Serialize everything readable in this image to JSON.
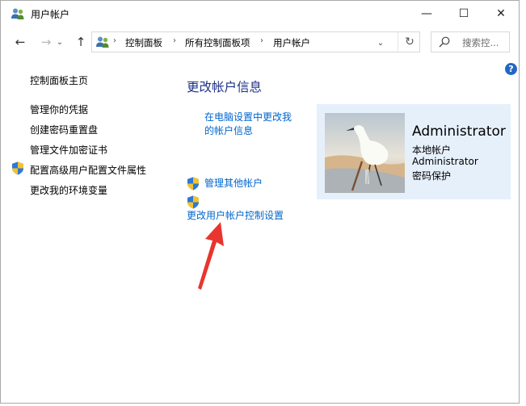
{
  "window": {
    "title": "用户帐户"
  },
  "titlebar": {
    "minimize": "—",
    "maximize": "☐",
    "close": "✕"
  },
  "nav": {
    "back_icon": "←",
    "forward_icon": "→",
    "recent_icon": "⌄",
    "up_icon": "↑",
    "breadcrumb": [
      "控制面板",
      "所有控制面板项",
      "用户帐户"
    ],
    "separator": "›",
    "dropdown_icon": "⌄",
    "refresh_icon": "↻",
    "search_placeholder": "搜索控..."
  },
  "help_label": "?",
  "sidebar": {
    "items": [
      {
        "label": "控制面板主页",
        "shield": false
      },
      {
        "label": "管理你的凭据",
        "shield": false
      },
      {
        "label": "创建密码重置盘",
        "shield": false
      },
      {
        "label": "管理文件加密证书",
        "shield": false
      },
      {
        "label": "配置高级用户配置文件属性",
        "shield": true
      },
      {
        "label": "更改我的环境变量",
        "shield": false
      }
    ]
  },
  "main": {
    "heading": "更改帐户信息",
    "pc_settings_link": [
      "在电脑设置中更改我",
      "的帐户信息"
    ],
    "manage_other": "管理其他帐户",
    "uac_settings": "更改用户帐户控制设置"
  },
  "user": {
    "name": "Administrator",
    "lines": [
      "本地帐户",
      "Administrator",
      "密码保护"
    ]
  },
  "colors": {
    "heading": "#1e3287",
    "link": "#0066cc",
    "panel": "#e6f0fb",
    "arrow": "#e8352e"
  },
  "icons": [
    "users-icon",
    "back-arrow-icon",
    "forward-arrow-icon",
    "up-arrow-icon",
    "refresh-icon",
    "search-icon",
    "help-icon",
    "uac-shield-icon",
    "annotation-arrow"
  ]
}
